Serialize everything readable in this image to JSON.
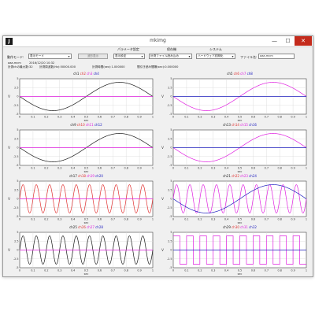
{
  "window": {
    "title": "mkimg",
    "icon_glyph": "J",
    "min_glyph": "—",
    "max_glyph": "☐",
    "close_glyph": "✕"
  },
  "toolbar": {
    "mode_label": "動作モード:",
    "mode_value": "表示モード",
    "display_button": "波形表示",
    "param_label": "パラメータ設定",
    "param_value": "表示設定",
    "target_label": "保存機",
    "target_value": "計測ファイル読み込み",
    "system_label": "システム",
    "system_value": "ハードウェア初期化",
    "filename_label": "ファイル名:",
    "filename_value": "aaa.mcm"
  },
  "info": {
    "file_name": "aaa.mcm",
    "date_time": "2016/12/20 10:32",
    "channels": "計測chの最大数:32",
    "sampling": "計測周波数(Hz):50000.000",
    "duration": "計測時間(sec):1.000000",
    "read_interval": "間引き読み間隔(sec):0.000000"
  },
  "axis": {
    "xlabel": "sec",
    "ylabel": "V"
  },
  "panels": [
    {
      "channels": [
        "ch1",
        "ch2",
        "ch3",
        "ch4"
      ],
      "x_ticks": [
        "0",
        "0.1",
        "0.2",
        "0.3",
        "0.4",
        "0.5",
        "0.6",
        "0.7",
        "0.8",
        "0.9",
        "1"
      ],
      "y_ticks": [
        "5",
        "2.5",
        "0",
        "-2.5",
        "-5"
      ]
    },
    {
      "channels": [
        "ch5",
        "ch6",
        "ch7",
        "ch8"
      ],
      "x_ticks": [
        "0",
        "0.1",
        "0.2",
        "0.3",
        "0.4",
        "0.5",
        "0.6",
        "0.7",
        "0.8",
        "0.9",
        "1"
      ],
      "y_ticks": [
        "5",
        "2.5",
        "0",
        "-2.5",
        "-5"
      ]
    },
    {
      "channels": [
        "ch9",
        "ch10",
        "ch11",
        "ch12"
      ],
      "x_ticks": [
        "0",
        "0.1",
        "0.2",
        "0.3",
        "0.4",
        "0.5",
        "0.6",
        "0.7",
        "0.8",
        "0.9",
        "1"
      ],
      "y_ticks": [
        "5",
        "2.5",
        "0",
        "-2.5",
        "-5"
      ]
    },
    {
      "channels": [
        "ch13",
        "ch14",
        "ch15",
        "ch16"
      ],
      "x_ticks": [
        "0",
        "0.1",
        "0.2",
        "0.3",
        "0.4",
        "0.5",
        "0.6",
        "0.7",
        "0.8",
        "0.9",
        "1"
      ],
      "y_ticks": [
        "5",
        "2.5",
        "0",
        "-2.5",
        "-5"
      ]
    },
    {
      "channels": [
        "ch17",
        "ch18",
        "ch19",
        "ch20"
      ],
      "x_ticks": [
        "0",
        "0.1",
        "0.2",
        "0.3",
        "0.4",
        "0.5",
        "0.6",
        "0.7",
        "0.8",
        "0.9",
        "1"
      ],
      "y_ticks": [
        "5",
        "2.5",
        "0",
        "-2.5",
        "-5"
      ]
    },
    {
      "channels": [
        "ch21",
        "ch22",
        "ch23",
        "ch24"
      ],
      "x_ticks": [
        "0",
        "0.1",
        "0.2",
        "0.3",
        "0.4",
        "0.5",
        "0.6",
        "0.7",
        "0.8",
        "0.9",
        "1"
      ],
      "y_ticks": [
        "5",
        "2.5",
        "0",
        "-2.5",
        "-5"
      ]
    },
    {
      "channels": [
        "ch25",
        "ch26",
        "ch27",
        "ch28"
      ],
      "x_ticks": [
        "0",
        "0.1",
        "0.2",
        "0.3",
        "0.4",
        "0.5",
        "0.6",
        "0.7",
        "0.8",
        "0.9",
        "1"
      ],
      "y_ticks": [
        "5",
        "2.5",
        "0",
        "-2.5",
        "-5"
      ]
    },
    {
      "channels": [
        "ch29",
        "ch30",
        "ch31",
        "ch32"
      ],
      "x_ticks": [
        "0",
        "0.1",
        "0.2",
        "0.3",
        "0.4",
        "0.5",
        "0.6",
        "0.7",
        "0.8",
        "0.9",
        "1"
      ],
      "y_ticks": [
        "5",
        "2.5",
        "0",
        "-2.5",
        "-5"
      ]
    }
  ],
  "colors": {
    "ch_a": "#1a1a1a",
    "ch_b": "#e03030",
    "ch_c": "#e020e0",
    "ch_d": "#2020c0",
    "zero_line": "#d020d0",
    "close_button": "#c42b1c"
  },
  "chart_data": [
    {
      "type": "line",
      "title": "ch1 ch2 ch3 ch4",
      "xlabel": "sec",
      "ylabel": "V",
      "xlim": [
        0,
        1
      ],
      "ylim": [
        -5,
        5
      ],
      "series": [
        {
          "name": "ch1",
          "shape": "sine",
          "amplitude": 4,
          "frequency_hz": 1,
          "phase_deg": 180,
          "color": "#1a1a1a"
        },
        {
          "name": "ch3",
          "shape": "flat",
          "level": 0,
          "color": "#e020e0"
        }
      ]
    },
    {
      "type": "line",
      "title": "ch5 ch6 ch7 ch8",
      "xlabel": "sec",
      "ylabel": "V",
      "xlim": [
        0,
        1
      ],
      "ylim": [
        -5,
        5
      ],
      "series": [
        {
          "name": "ch7",
          "shape": "sine",
          "amplitude": 4,
          "frequency_hz": 1,
          "phase_deg": 180,
          "color": "#e020e0"
        },
        {
          "name": "ch8",
          "shape": "flat",
          "level": 0,
          "color": "#2020c0"
        }
      ]
    },
    {
      "type": "line",
      "title": "ch9 ch10 ch11 ch12",
      "xlabel": "sec",
      "ylabel": "V",
      "xlim": [
        0,
        1
      ],
      "ylim": [
        -5,
        5
      ],
      "series": [
        {
          "name": "ch9",
          "shape": "sine",
          "amplitude": 4,
          "frequency_hz": 1,
          "phase_deg": 180,
          "color": "#1a1a1a"
        },
        {
          "name": "ch11",
          "shape": "flat",
          "level": 0,
          "color": "#e020e0"
        }
      ]
    },
    {
      "type": "line",
      "title": "ch13 ch14 ch15 ch16",
      "xlabel": "sec",
      "ylabel": "V",
      "xlim": [
        0,
        1
      ],
      "ylim": [
        -5,
        5
      ],
      "series": [
        {
          "name": "ch15",
          "shape": "sine",
          "amplitude": 4,
          "frequency_hz": 1,
          "phase_deg": 180,
          "color": "#e020e0"
        },
        {
          "name": "ch16",
          "shape": "flat",
          "level": 0,
          "color": "#2020c0"
        }
      ]
    },
    {
      "type": "line",
      "title": "ch17 ch18 ch19 ch20",
      "xlabel": "sec",
      "ylabel": "V",
      "xlim": [
        0,
        1
      ],
      "ylim": [
        -5,
        5
      ],
      "series": [
        {
          "name": "ch18",
          "shape": "sine",
          "amplitude": 4,
          "frequency_hz": 10,
          "phase_deg": 0,
          "color": "#e03030"
        },
        {
          "name": "ch19",
          "shape": "flat",
          "level": 0,
          "color": "#e020e0"
        }
      ]
    },
    {
      "type": "line",
      "title": "ch21 ch22 ch23 ch24",
      "xlabel": "sec",
      "ylabel": "V",
      "xlim": [
        0,
        1
      ],
      "ylim": [
        -5,
        5
      ],
      "series": [
        {
          "name": "ch23",
          "shape": "sine",
          "amplitude": 4,
          "frequency_hz": 10,
          "phase_deg": 0,
          "color": "#e020e0"
        },
        {
          "name": "ch24",
          "shape": "sine",
          "amplitude": 4,
          "frequency_hz": 1,
          "phase_deg": 180,
          "color": "#2020c0"
        }
      ]
    },
    {
      "type": "line",
      "title": "ch25 ch26 ch27 ch28",
      "xlabel": "sec",
      "ylabel": "V",
      "xlim": [
        0,
        1
      ],
      "ylim": [
        -5,
        5
      ],
      "series": [
        {
          "name": "ch25",
          "shape": "sine",
          "amplitude": 4,
          "frequency_hz": 10,
          "phase_deg": 0,
          "color": "#1a1a1a"
        },
        {
          "name": "ch27",
          "shape": "flat",
          "level": 0,
          "color": "#e020e0"
        }
      ]
    },
    {
      "type": "line",
      "title": "ch29 ch30 ch31 ch32",
      "xlabel": "sec",
      "ylabel": "V",
      "xlim": [
        0,
        1
      ],
      "ylim": [
        -5,
        5
      ],
      "series": [
        {
          "name": "ch30",
          "shape": "square",
          "amplitude": 4,
          "frequency_hz": 10,
          "color": "#e020e0"
        },
        {
          "name": "ch32",
          "shape": "flat",
          "level": 0,
          "color": "#2020c0"
        }
      ]
    }
  ]
}
